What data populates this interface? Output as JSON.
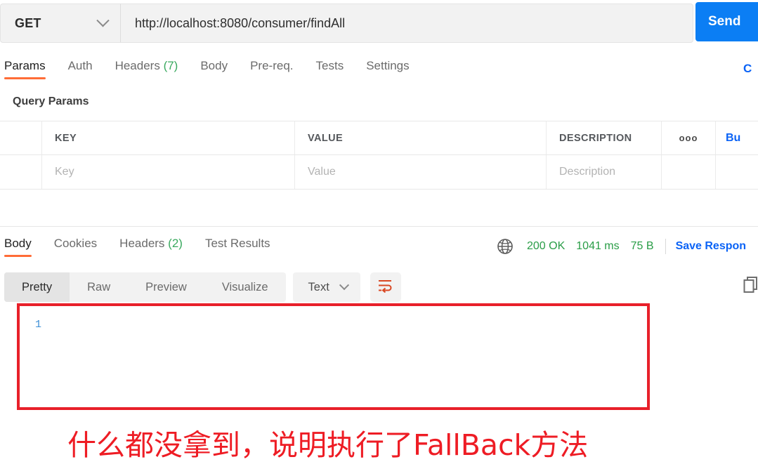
{
  "request": {
    "method": "GET",
    "method_icon": "chevron-down-icon",
    "url": "http://localhost:8080/consumer/findAll",
    "url_placeholder": "Enter request URL",
    "send_label": "Send",
    "cookies_link": "C"
  },
  "request_tabs": [
    {
      "label": "Params",
      "count": "",
      "active": true
    },
    {
      "label": "Auth",
      "count": "",
      "active": false
    },
    {
      "label": "Headers",
      "count": "(7)",
      "active": false
    },
    {
      "label": "Body",
      "count": "",
      "active": false
    },
    {
      "label": "Pre-req.",
      "count": "",
      "active": false
    },
    {
      "label": "Tests",
      "count": "",
      "active": false
    },
    {
      "label": "Settings",
      "count": "",
      "active": false
    }
  ],
  "query_params": {
    "section_title": "Query Params",
    "columns": [
      "KEY",
      "VALUE",
      "DESCRIPTION"
    ],
    "menu_icon": "ooo",
    "bulk_edit_label": "Bu",
    "rows": [
      {
        "key": "Key",
        "value": "Value",
        "description": "Description"
      }
    ]
  },
  "response_tabs": [
    {
      "label": "Body",
      "count": "",
      "active": true
    },
    {
      "label": "Cookies",
      "count": "",
      "active": false
    },
    {
      "label": "Headers",
      "count": "(2)",
      "active": false
    },
    {
      "label": "Test Results",
      "count": "",
      "active": false
    }
  ],
  "response_status": {
    "network_icon": "globe-icon",
    "status": "200 OK",
    "time": "1041 ms",
    "size": "75 B",
    "save_response_label": "Save Respon"
  },
  "view_toolbar": {
    "segments": [
      {
        "label": "Pretty",
        "active": true
      },
      {
        "label": "Raw",
        "active": false
      },
      {
        "label": "Preview",
        "active": false
      },
      {
        "label": "Visualize",
        "active": false
      }
    ],
    "format": "Text",
    "format_icon": "chevron-down-icon",
    "wrap_icon": "word-wrap-icon",
    "copy_icon": "copy-icon"
  },
  "response_body": {
    "line_numbers": [
      "1"
    ],
    "content": ""
  },
  "annotation": {
    "text": "什么都没拿到，说明执行了FallBack方法"
  },
  "colors": {
    "accent_orange": "#ff6c37",
    "send_blue": "#0b7ef4",
    "link_blue": "#0b63f6",
    "status_green": "#2a9d47",
    "annotation_red": "#ee1c24",
    "box_red": "#e8202a"
  }
}
